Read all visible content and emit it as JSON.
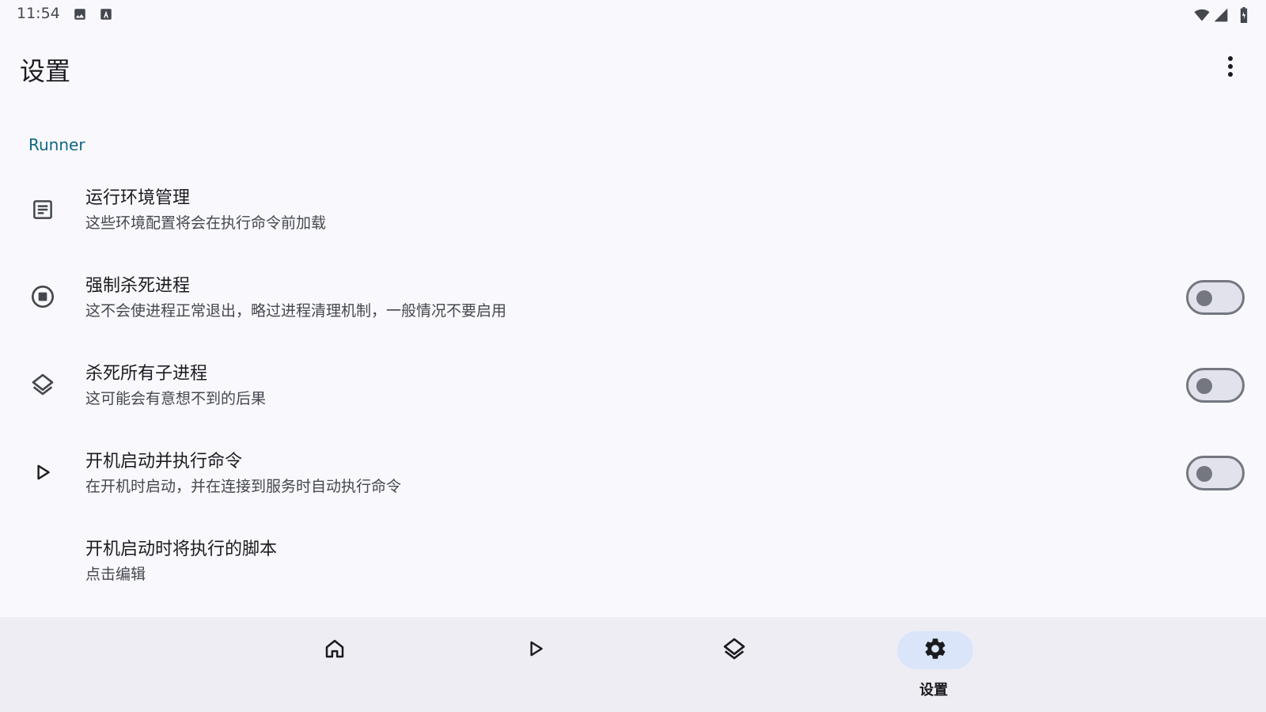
{
  "status_bar": {
    "time": "11:54",
    "left_icons": [
      "image-icon",
      "keyboard-a-icon"
    ],
    "right_icons": [
      "wifi-icon",
      "signal-icon",
      "battery-icon"
    ]
  },
  "app_bar": {
    "title": "设置",
    "menu_icon": "more-vert-icon"
  },
  "section": {
    "title": "Runner"
  },
  "preferences": [
    {
      "title": "运行环境管理",
      "summary": "这些环境配置将会在执行命令前加载",
      "icon": "article-icon",
      "has_switch": false
    },
    {
      "title": "强制杀死进程",
      "summary": "这不会使进程正常退出，略过进程清理机制，一般情况不要启用",
      "icon": "stop-circle-icon",
      "has_switch": true,
      "checked": false
    },
    {
      "title": "杀死所有子进程",
      "summary": "这可能会有意想不到的后果",
      "icon": "layers-icon",
      "has_switch": true,
      "checked": false
    },
    {
      "title": "开机启动并执行命令",
      "summary": "在开机时启动，并在连接到服务时自动执行命令",
      "icon": "play-icon",
      "has_switch": true,
      "checked": false
    },
    {
      "title": "开机启动时将执行的脚本",
      "summary": "点击编辑",
      "icon": "",
      "has_switch": false
    }
  ],
  "bottom_nav": {
    "items": [
      {
        "icon": "home-icon",
        "label": "",
        "active": false
      },
      {
        "icon": "play-icon",
        "label": "",
        "active": false
      },
      {
        "icon": "layers-icon",
        "label": "",
        "active": false
      },
      {
        "icon": "settings-gear-icon",
        "label": "设置",
        "active": true
      }
    ]
  },
  "colors": {
    "background": "#f9f9fd",
    "accent": "#0e6783",
    "nav_background": "#ededf3",
    "nav_active_pill": "#dbe5fa",
    "switch_off_track": "#e1e2ec",
    "switch_off_outline": "#74777f"
  }
}
